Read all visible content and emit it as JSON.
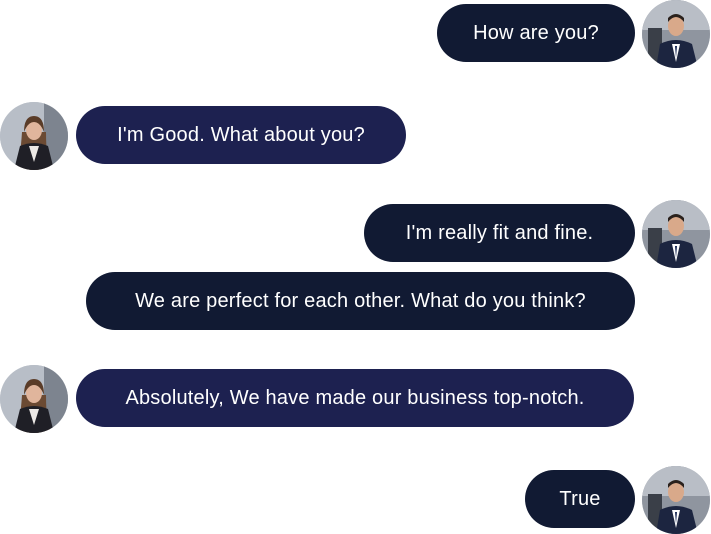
{
  "conversation": {
    "messages": [
      {
        "sender": "man",
        "text": "How are you?"
      },
      {
        "sender": "woman",
        "text": "I'm Good. What about you?"
      },
      {
        "sender": "man",
        "text": "I'm really fit and fine."
      },
      {
        "sender": "man",
        "text": "We are perfect for each other. What do you think?"
      },
      {
        "sender": "woman",
        "text": "Absolutely, We have made our business top-notch."
      },
      {
        "sender": "man",
        "text": "True"
      }
    ]
  },
  "avatars": {
    "man": "man-avatar-icon",
    "woman": "woman-avatar-icon"
  },
  "colors": {
    "sent_bubble": "#111a33",
    "received_bubble": "#1d2150",
    "bubble_text": "#ffffff",
    "background": "#ffffff"
  }
}
